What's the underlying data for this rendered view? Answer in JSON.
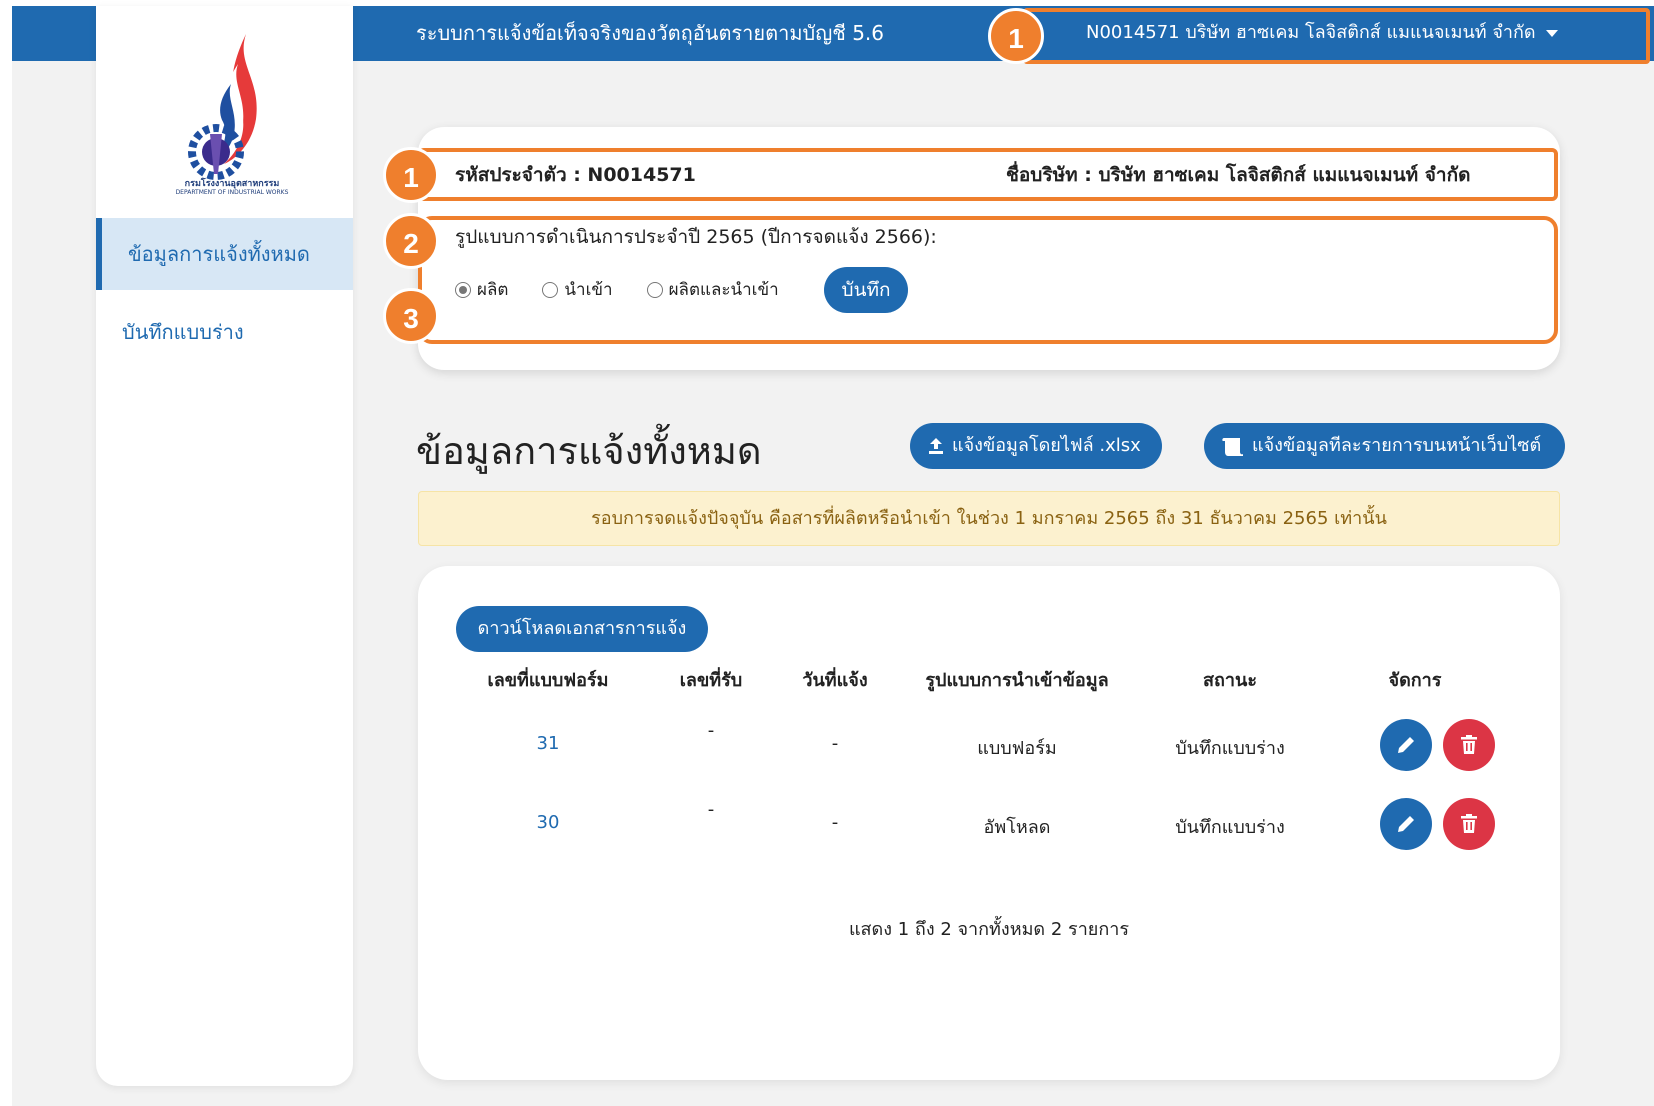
{
  "topbar": {
    "title": "ระบบการแจ้งข้อเท็จจริงของวัตถุอันตรายตามบัญชี 5.6",
    "company_menu": "N0014571 บริษัท ฮาซเคม โลจิสติกส์ แมแนจเมนท์ จำกัด"
  },
  "logo": {
    "text_th": "กรมโรงงานอุตสาหกรรม",
    "text_en": "DEPARTMENT OF INDUSTRIAL WORKS"
  },
  "sidebar": {
    "items": [
      {
        "label": "ข้อมูลการแจ้งทั้งหมด"
      },
      {
        "label": "บันทึกแบบร่าง"
      }
    ]
  },
  "info": {
    "code_label": "รหัสประจำตัว : N0014571",
    "company_label": "ชื่อบริษัท : บริษัท ฮาซเคม โลจิสติกส์ แมแนจเมนท์ จำกัด",
    "mode_label": "รูปแบบการดำเนินการประจำปี 2565 (ปีการจดแจ้ง 2566):",
    "options": [
      "ผลิต",
      "นำเข้า",
      "ผลิตและนำเข้า"
    ],
    "selected": "ผลิต",
    "save_label": "บันทึก"
  },
  "callouts": [
    "1",
    "1",
    "2",
    "3"
  ],
  "main": {
    "title": "ข้อมูลการแจ้งทั้งหมด",
    "upload_label": "แจ้งข้อมูลโดยไฟล์ .xlsx",
    "web_label": "แจ้งข้อมูลทีละรายการบนหน้าเว็บไซต์",
    "notice": "รอบการจดแจ้งปัจจุบัน คือสารที่ผลิตหรือนำเข้า ในช่วง 1 มกราคม 2565 ถึง 31 ธันวาคม 2565 เท่านั้น",
    "download_label": "ดาวน์โหลดเอกสารการแจ้ง"
  },
  "table": {
    "headers": [
      "เลขที่แบบฟอร์ม",
      "เลขที่รับ",
      "วันที่แจ้ง",
      "รูปแบบการนำเข้าข้อมูล",
      "สถานะ",
      "จัดการ"
    ],
    "rows": [
      {
        "form_no": "31",
        "receive_no": "-",
        "date": "-",
        "input_type": "แบบฟอร์ม",
        "status": "บันทึกแบบร่าง"
      },
      {
        "form_no": "30",
        "receive_no": "-",
        "date": "-",
        "input_type": "อัพโหลด",
        "status": "บันทึกแบบร่าง"
      }
    ],
    "footer": "แสดง 1 ถึง 2 จากทั้งหมด 2 รายการ"
  },
  "colors": {
    "primary": "#1f6ab0",
    "callout": "#ef7f2d",
    "danger": "#dc3545",
    "notice_bg": "#fcf1cf"
  }
}
